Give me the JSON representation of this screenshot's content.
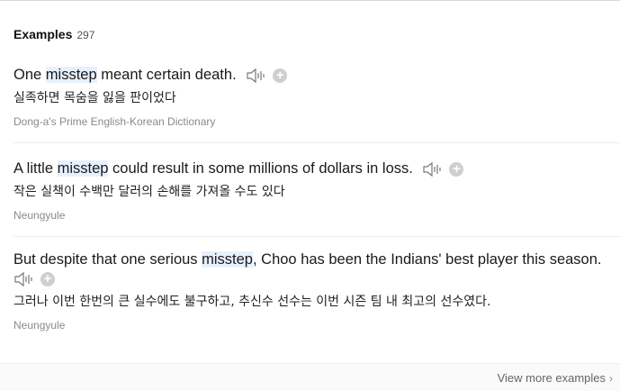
{
  "header": {
    "title": "Examples",
    "count": "297"
  },
  "examples": [
    {
      "pre": "One ",
      "highlight": "misstep",
      "post": " meant certain death.",
      "ko": "실족하면 목숨을 잃을 판이었다",
      "source": "Dong-a's Prime English-Korean Dictionary"
    },
    {
      "pre": "A little ",
      "highlight": "misstep",
      "post": " could result in some millions of dollars in loss.",
      "ko": "작은 실책이 수백만 달러의 손해를 가져올 수도 있다",
      "source": "Neungyule"
    },
    {
      "pre": "But despite that one serious ",
      "highlight": "misstep",
      "post": ", Choo has been the Indians' best player this season.",
      "ko": "그러나 이번 한번의 큰 실수에도 불구하고, 추신수 선수는 이번 시즌 팀 내 최고의 선수였다.",
      "source": "Neungyule"
    }
  ],
  "icons": {
    "speaker": "speaker-icon",
    "add": "plus-icon",
    "chevron": "chevron-right-icon"
  },
  "footer": {
    "more_label": "View more examples"
  },
  "colors": {
    "highlight_bg": "#e6f1fd",
    "plus_bg": "#cfcfcf",
    "source_text": "#8a8a8a"
  }
}
